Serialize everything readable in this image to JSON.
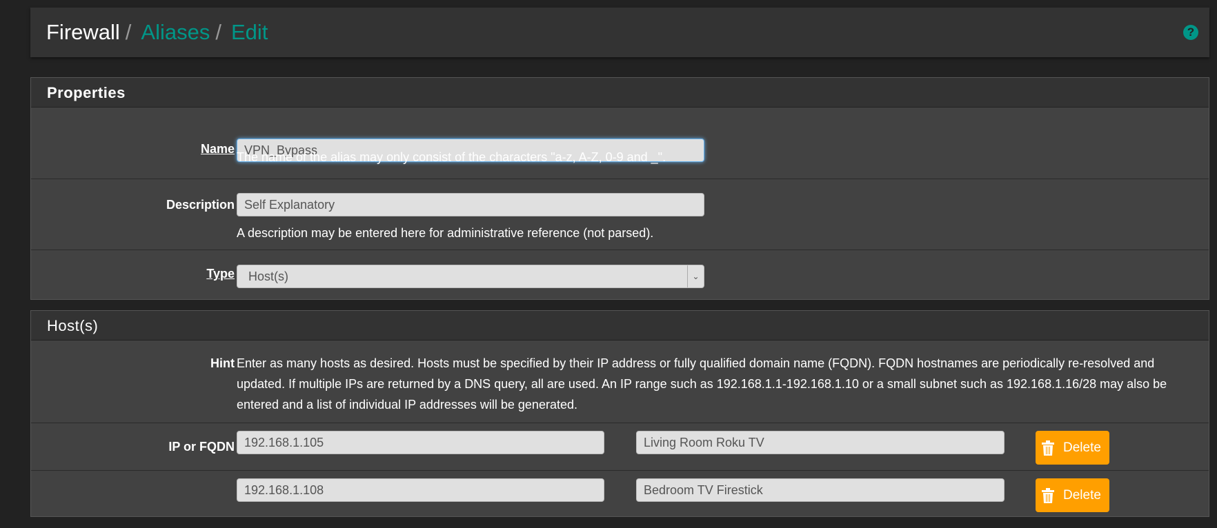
{
  "breadcrumb": {
    "root": "Firewall",
    "items": [
      "Aliases",
      "Edit"
    ],
    "separator": "/"
  },
  "help_icon": "question-circle-icon",
  "accent_color": "#009688",
  "danger_color": "#ff9f00",
  "properties": {
    "title": "Properties",
    "name": {
      "label": "Name",
      "value": "VPN_Bypass",
      "help": "The name of the alias may only consist of the characters \"a-z, A-Z, 0-9 and _\"."
    },
    "description": {
      "label": "Description",
      "value": "Self Explanatory",
      "help": "A description may be entered here for administrative reference (not parsed)."
    },
    "type": {
      "label": "Type",
      "value": "Host(s)"
    }
  },
  "hosts": {
    "title": "Host(s)",
    "hint_label": "Hint",
    "hint": "Enter as many hosts as desired. Hosts must be specified by their IP address or fully qualified domain name (FQDN). FQDN hostnames are periodically re-resolved and updated. If multiple IPs are returned by a DNS query, all are used. An IP range such as 192.168.1.1-192.168.1.10 or a small subnet such as 192.168.1.16/28 may also be entered and a list of individual IP addresses will be generated.",
    "entry_label": "IP or FQDN",
    "delete_label": "Delete",
    "entries": [
      {
        "address": "192.168.1.105",
        "description": "Living Room Roku TV"
      },
      {
        "address": "192.168.1.108",
        "description": "Bedroom TV Firestick"
      }
    ]
  }
}
